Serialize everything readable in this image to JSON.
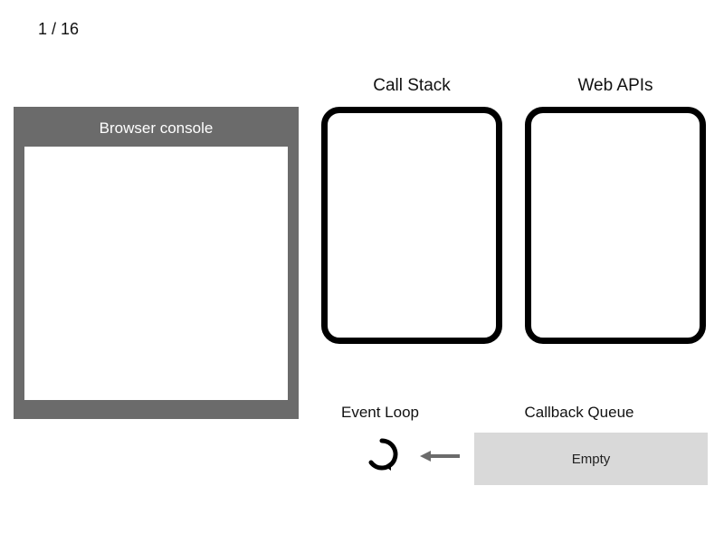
{
  "counter": {
    "current": 1,
    "total": 16,
    "separator": " / "
  },
  "console": {
    "title": "Browser console"
  },
  "callStack": {
    "title": "Call Stack"
  },
  "webApis": {
    "title": "Web APIs"
  },
  "eventLoop": {
    "title": "Event Loop"
  },
  "callbackQueue": {
    "title": "Callback Queue",
    "state": "Empty"
  }
}
